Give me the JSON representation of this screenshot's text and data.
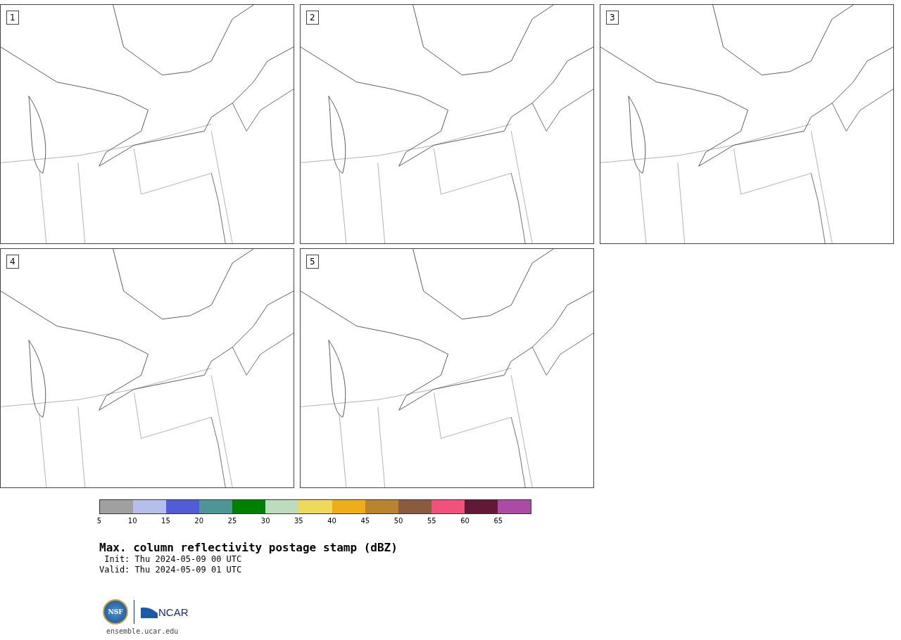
{
  "panels": [
    {
      "label": "1"
    },
    {
      "label": "2"
    },
    {
      "label": "3"
    },
    {
      "label": "4"
    },
    {
      "label": "5"
    }
  ],
  "colorbar": {
    "segments": [
      {
        "color": "#a0a0a0"
      },
      {
        "color": "#b4bfeb"
      },
      {
        "color": "#515dd6"
      },
      {
        "color": "#4e9598"
      },
      {
        "color": "#008000"
      },
      {
        "color": "#bddcbd"
      },
      {
        "color": "#efd95a"
      },
      {
        "color": "#eeae17"
      },
      {
        "color": "#ba842f"
      },
      {
        "color": "#8b5a3f"
      },
      {
        "color": "#f4507c"
      },
      {
        "color": "#621837"
      },
      {
        "color": "#ac4aa6"
      }
    ],
    "ticks": [
      "5",
      "10",
      "15",
      "20",
      "25",
      "30",
      "35",
      "40",
      "45",
      "50",
      "55",
      "60",
      "65"
    ]
  },
  "title": "Max. column reflectivity postage stamp (dBZ)",
  "init": " Init: Thu 2024-05-09 00 UTC",
  "valid": "Valid: Thu 2024-05-09 01 UTC",
  "logos": {
    "nsf": "NSF",
    "ncar": "NCAR"
  },
  "footer": "ensemble.ucar.edu"
}
